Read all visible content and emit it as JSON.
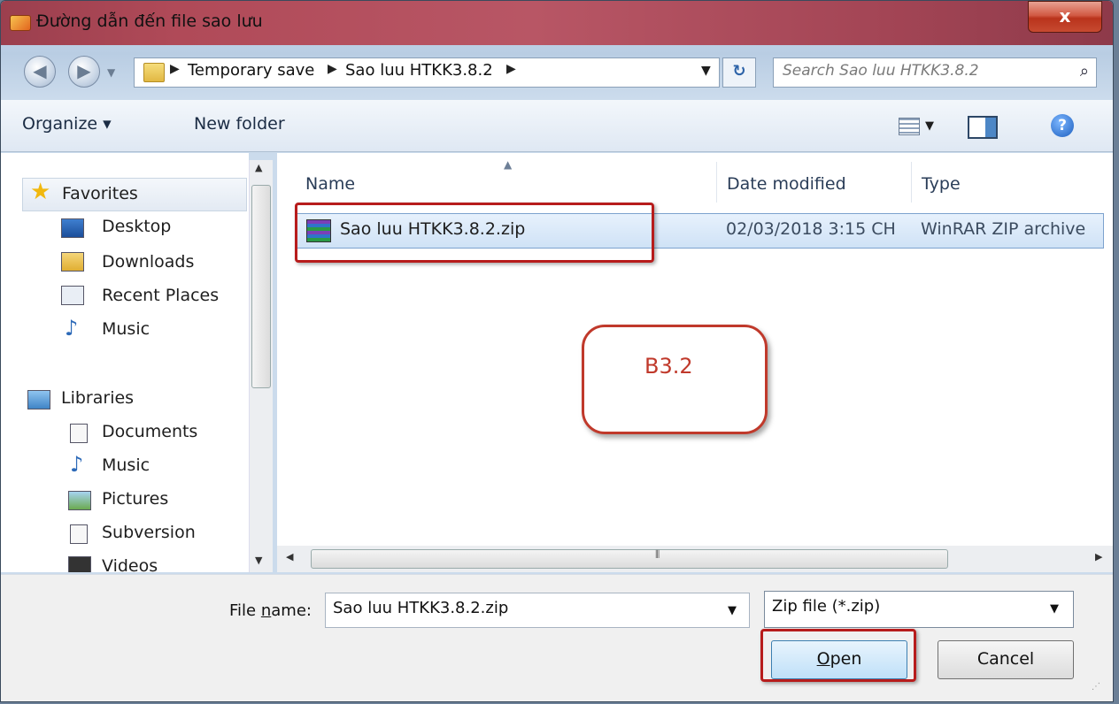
{
  "window": {
    "title": "Đường dẫn đến file sao lưu",
    "close_glyph": "x"
  },
  "address": {
    "crumbs": [
      "Temporary save",
      "Sao luu HTKK3.8.2"
    ],
    "search_placeholder": "Search Sao luu HTKK3.8.2"
  },
  "toolbar": {
    "organize": "Organize ▾",
    "new_folder": "New folder"
  },
  "nav": {
    "favorites": "Favorites",
    "fav_items": [
      "Desktop",
      "Downloads",
      "Recent Places",
      "Music"
    ],
    "libraries": "Libraries",
    "lib_items": [
      "Documents",
      "Music",
      "Pictures",
      "Subversion",
      "Videos"
    ]
  },
  "columns": {
    "name": "Name",
    "date": "Date modified",
    "type": "Type"
  },
  "files": [
    {
      "name": "Sao luu HTKK3.8.2.zip",
      "date": "02/03/2018 3:15 CH",
      "type": "WinRAR ZIP archive"
    }
  ],
  "callout": {
    "text": "B3.2"
  },
  "bottom": {
    "file_name_label_pre": "File ",
    "file_name_label_u": "n",
    "file_name_label_post": "ame:",
    "file_name_value": "Sao luu HTKK3.8.2.zip",
    "filter_value": "Zip file (*.zip)",
    "open_u": "O",
    "open_rest": "pen",
    "cancel": "Cancel"
  },
  "icons": [
    "app-icon",
    "close-icon",
    "back-icon",
    "forward-icon",
    "folder-icon",
    "refresh-icon",
    "search-icon",
    "view-icon",
    "preview-pane-icon",
    "help-icon",
    "star-icon",
    "desktop-icon",
    "downloads-icon",
    "recent-places-icon",
    "music-icon",
    "libraries-icon",
    "documents-icon",
    "pictures-icon",
    "subversion-icon",
    "videos-icon",
    "winrar-icon"
  ]
}
